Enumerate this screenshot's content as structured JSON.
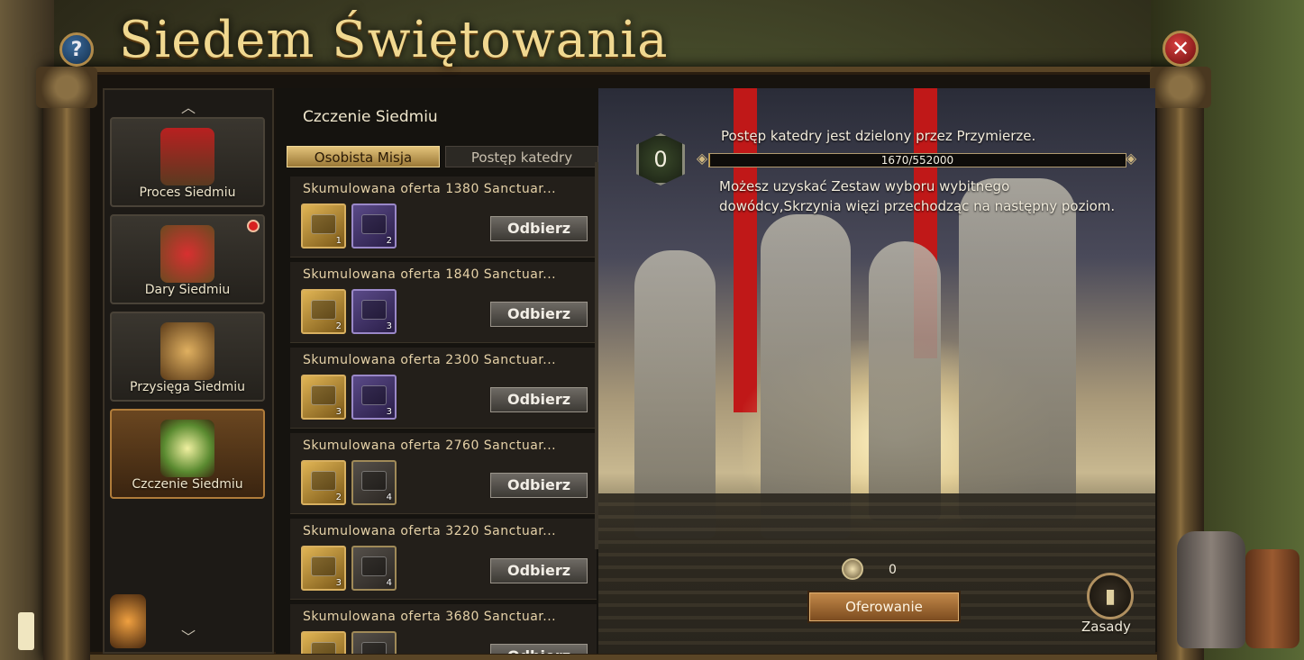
{
  "window": {
    "title": "Siedem Świętowania",
    "help_label": "?",
    "close_label": "✕"
  },
  "sidebar": {
    "up_arrow": "︿",
    "down_arrow": "﹀",
    "items": [
      {
        "label": "Proces Siedmiu",
        "icon": "statue-banner-icon",
        "active": false,
        "badge": false
      },
      {
        "label": "Dary Siedmiu",
        "icon": "goblet-icon",
        "active": false,
        "badge": true
      },
      {
        "label": "Przysięga Siedmiu",
        "icon": "scales-book-icon",
        "active": false,
        "badge": false
      },
      {
        "label": "Czczenie Siedmiu",
        "icon": "cathedral-icon",
        "active": true,
        "badge": false
      }
    ]
  },
  "mission": {
    "section_title": "Czczenie Siedmiu",
    "tabs": [
      {
        "label": "Osobista Misja",
        "active": true
      },
      {
        "label": "Postęp katedry",
        "active": false
      }
    ],
    "claim_label": "Odbierz",
    "tasks": [
      {
        "title": "Skumulowana oferta 1380 Sanctuar...",
        "gold_count": "1",
        "second_count": "2",
        "second_type": "purple"
      },
      {
        "title": "Skumulowana oferta 1840 Sanctuar...",
        "gold_count": "2",
        "second_count": "3",
        "second_type": "purple"
      },
      {
        "title": "Skumulowana oferta 2300 Sanctuar...",
        "gold_count": "3",
        "second_count": "3",
        "second_type": "purple"
      },
      {
        "title": "Skumulowana oferta 2760 Sanctuar...",
        "gold_count": "2",
        "second_count": "4",
        "second_type": "dark"
      },
      {
        "title": "Skumulowana oferta 3220 Sanctuar...",
        "gold_count": "3",
        "second_count": "4",
        "second_type": "dark"
      },
      {
        "title": "Skumulowana oferta 3680 Sanctuar...",
        "gold_count": "",
        "second_count": "",
        "second_type": "dark"
      }
    ]
  },
  "cathedral": {
    "level": "0",
    "shared_text": "Postęp katedry jest dzielony przez Przymierze.",
    "progress_text": "1670/552000",
    "progress_fraction": 0.003,
    "reward_text": "Możesz uzyskać Zestaw wyboru wybitnego dowódcy,Skrzynia więzi przechodząc na następny poziom.",
    "coin_count": "0",
    "offer_label": "Oferowanie",
    "rules_label": "Zasady"
  },
  "colors": {
    "accent_gold": "#e2c27a",
    "progress_fill": "#c8a040",
    "badge_red": "#d82020",
    "close_red": "#d84040"
  }
}
